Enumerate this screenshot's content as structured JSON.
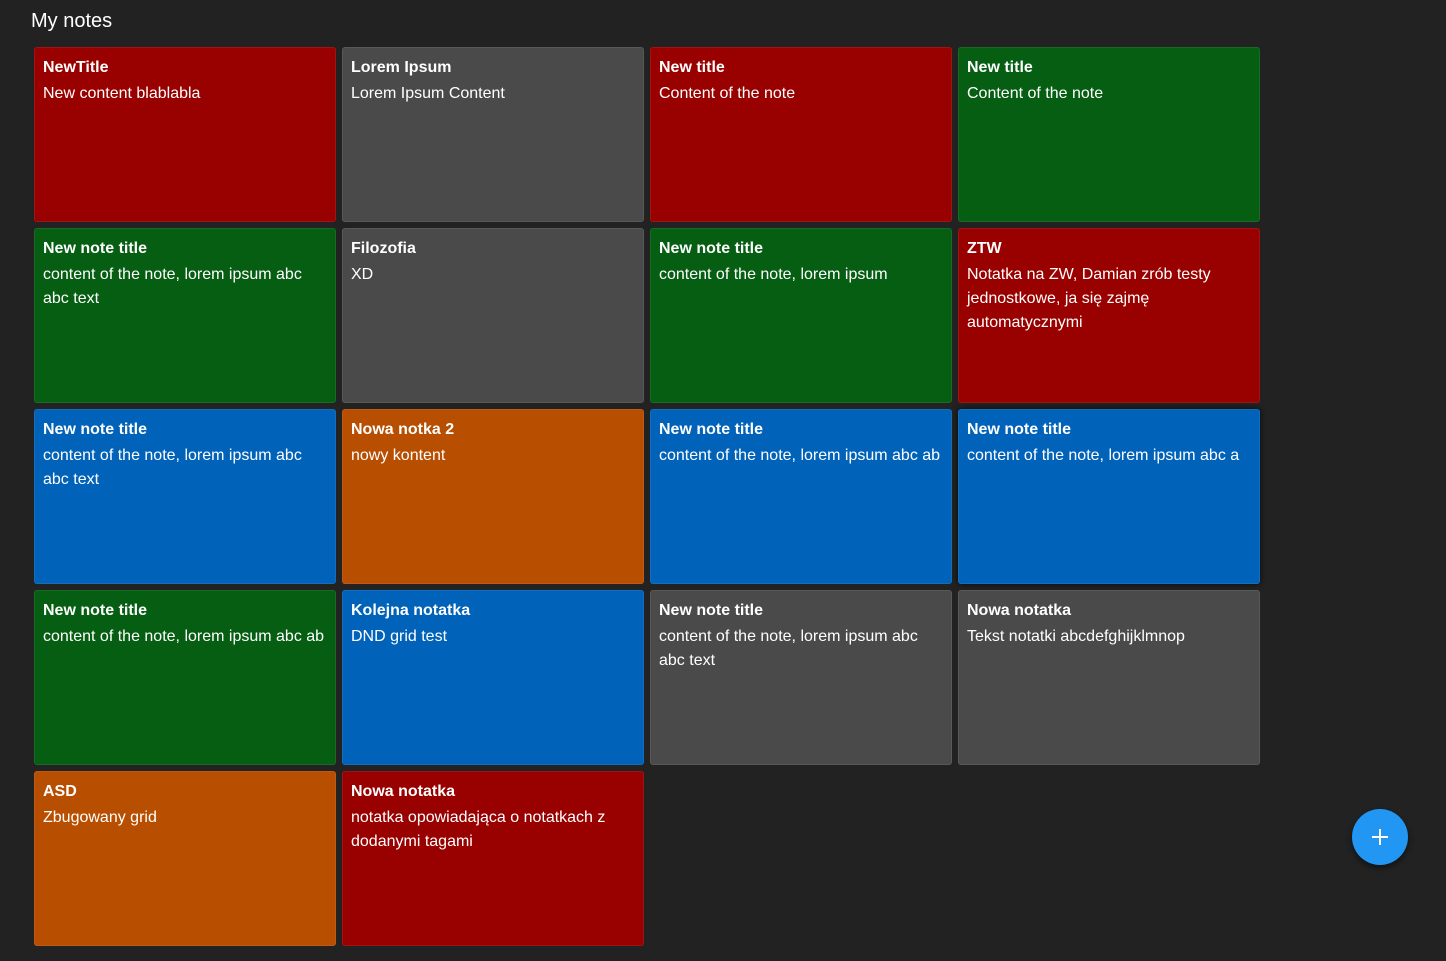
{
  "header": {
    "title": "My notes"
  },
  "notes": [
    {
      "title": "NewTitle",
      "content": "New content blablabla",
      "color": "#990000"
    },
    {
      "title": "Lorem Ipsum",
      "content": "Lorem Ipsum Content",
      "color": "#4a4a4a"
    },
    {
      "title": "New title",
      "content": "Content of the note",
      "color": "#990000"
    },
    {
      "title": "New title",
      "content": "Content of the note",
      "color": "#055e12"
    },
    {
      "title": "New note title",
      "content": "content of the note, lorem ipsum abc abc text",
      "color": "#055e12"
    },
    {
      "title": "Filozofia",
      "content": "XD",
      "color": "#4a4a4a"
    },
    {
      "title": "New note title",
      "content": "content of the note, lorem ipsum",
      "color": "#055e12"
    },
    {
      "title": "ZTW",
      "content": "Notatka na ZW, Damian zrób testy jednostkowe, ja się zajmę automatycznymi",
      "color": "#990000"
    },
    {
      "title": "New note title",
      "content": "content of the note, lorem ipsum abc abc text",
      "color": "#0062b9"
    },
    {
      "title": "Nowa notka 2",
      "content": "nowy kontent",
      "color": "#b84e00"
    },
    {
      "title": "New note title",
      "content": "content of the note, lorem ipsum abc ab",
      "color": "#0062b9"
    },
    {
      "title": "New note title",
      "content": "content of the note, lorem ipsum abc a",
      "color": "#0062b9"
    },
    {
      "title": "New note title",
      "content": "content of the note, lorem ipsum abc ab",
      "color": "#055e12"
    },
    {
      "title": "Kolejna notatka",
      "content": "DND grid test",
      "color": "#0062b9"
    },
    {
      "title": "New note title",
      "content": "content of the note, lorem ipsum abc abc text",
      "color": "#4a4a4a"
    },
    {
      "title": "Nowa notatka",
      "content": "Tekst notatki abcdefghijklmnop",
      "color": "#4a4a4a"
    },
    {
      "title": "ASD",
      "content": "Zbugowany grid",
      "color": "#b84e00"
    },
    {
      "title": "Nowa notatka",
      "content": "notatka opowiadająca o notatkach z dodanymi tagami",
      "color": "#990000"
    }
  ],
  "fab": {
    "icon": "plus-icon",
    "color": "#2196f3"
  }
}
